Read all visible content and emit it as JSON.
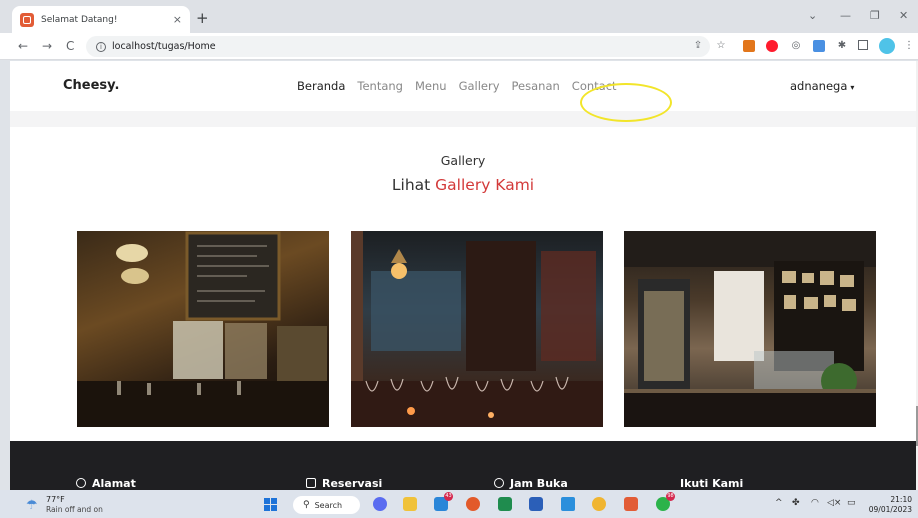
{
  "browser": {
    "tab_title": "Selamat Datang!",
    "tab_close": "×",
    "new_tab": "+",
    "minimize": "—",
    "restore": "❐",
    "close": "✕",
    "back": "←",
    "forward": "→",
    "reload": "C",
    "url": "localhost/tugas/Home"
  },
  "site": {
    "brand": "Cheesy.",
    "menu": [
      "Beranda",
      "Tentang",
      "Menu",
      "Gallery",
      "Pesanan",
      "Contact"
    ],
    "user": "adnanega",
    "user_caret": "▾"
  },
  "gallery": {
    "subtitle": "Gallery",
    "title_prefix": "Lihat",
    "title_accent": "Gallery Kami"
  },
  "footer": {
    "items": [
      "Alamat",
      "Reservasi",
      "Jam Buka",
      "Ikuti Kami"
    ]
  },
  "taskbar": {
    "temp": "77°F",
    "weather_desc": "Rain off and on",
    "search_label": "Search",
    "badge_a": "43",
    "badge_b": "98",
    "time": "21:10",
    "date": "09/01/2023"
  },
  "colors": {
    "accent_red": "#d33a3a",
    "highlight_yellow": "#f2e52a",
    "footer_bg": "#1f1f22"
  }
}
